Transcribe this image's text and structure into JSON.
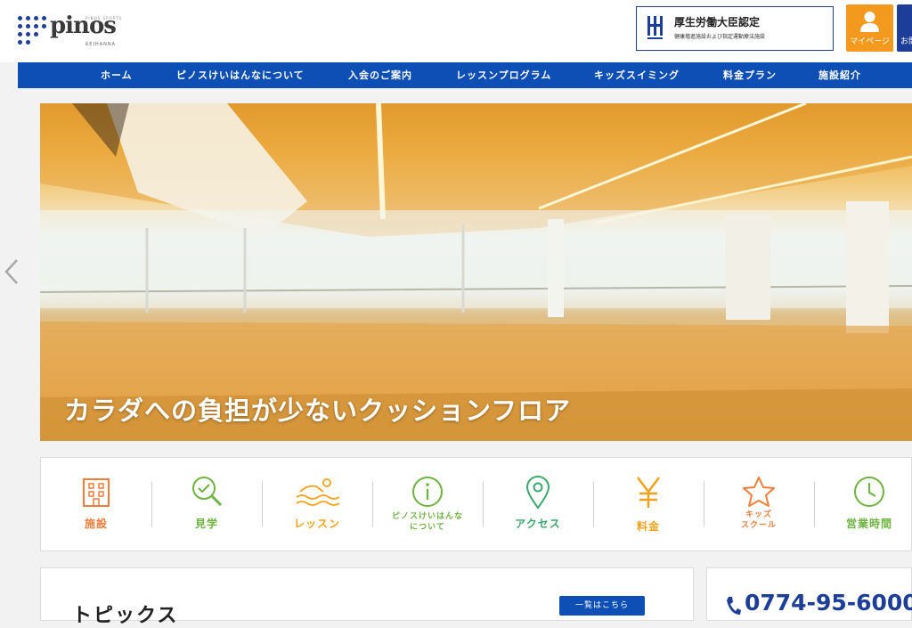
{
  "header": {
    "logo": {
      "text": "pinos",
      "tagline": "KEIHANNA",
      "top_small": "PINOS SPORTS"
    },
    "certification": {
      "title": "厚生労働大臣認定",
      "subtitle": "健康増進施設および指定運動療法施設"
    },
    "mypage_label": "マイページ",
    "extra_label": "お問"
  },
  "nav": {
    "items": [
      {
        "label": "ホーム"
      },
      {
        "label": "ピノスけいはんなについて"
      },
      {
        "label": "入会のご案内"
      },
      {
        "label": "レッスンプログラム"
      },
      {
        "label": "キッズスイミング"
      },
      {
        "label": "料金プラン"
      },
      {
        "label": "施設紹介"
      }
    ]
  },
  "hero": {
    "caption": "カラダへの負担が少ないクッションフロア"
  },
  "quick_links": [
    {
      "label": "施設",
      "icon": "building-icon",
      "color": "#f07d3a"
    },
    {
      "label": "見学",
      "icon": "search-check-icon",
      "color": "#6db33f"
    },
    {
      "label": "レッスン",
      "icon": "swimmer-icon",
      "color": "#f3a21c"
    },
    {
      "label_line1": "ピノスけいはんな",
      "label_line2": "について",
      "icon": "info-icon",
      "color": "#6db33f"
    },
    {
      "label": "アクセス",
      "icon": "map-pin-icon",
      "color": "#3aa86a"
    },
    {
      "label": "料金",
      "icon": "yen-icon",
      "color": "#f3a21c"
    },
    {
      "label_line1": "キッズ",
      "label_line2": "スクール",
      "icon": "star-icon",
      "color": "#f07d3a"
    },
    {
      "label": "営業時間",
      "icon": "clock-icon",
      "color": "#6db33f"
    }
  ],
  "topics": {
    "title": "トピックス",
    "button_label": "一覧はこちら"
  },
  "contact": {
    "phone": "0774-95-6000"
  },
  "colors": {
    "brand_blue": "#0d4fb5",
    "accent_orange": "#f39a1e"
  }
}
